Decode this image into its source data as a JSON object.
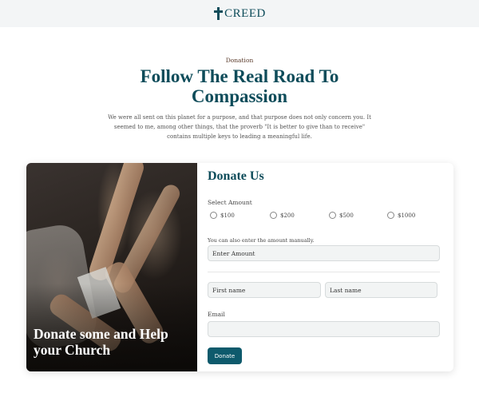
{
  "brand": {
    "name": "CREED"
  },
  "hero": {
    "eyebrow": "Donation",
    "title": "Follow The Real Road To Compassion",
    "intro": "We were all sent on this planet for a purpose, and that purpose does not only concern you. It seemed to me, among other things, that the proverb \"It is better to give than to receive\" contains multiple keys to leading a meaningful life."
  },
  "card": {
    "photo_caption": "Donate some and Help your Church",
    "form_title": "Donate Us",
    "select_amount_label": "Select Amount",
    "amounts": [
      "$100",
      "$200",
      "$500",
      "$1000"
    ],
    "manual_note": "You can also enter the amount manually.",
    "amount_placeholder": "Enter Amount",
    "first_name_placeholder": "First name",
    "last_name_placeholder": "Last name",
    "email_label": "Email",
    "email_value": "",
    "submit_label": "Donate"
  },
  "colors": {
    "brand": "#0e4c5a",
    "button": "#0e5a6c",
    "topbar": "#f3f5f6"
  }
}
